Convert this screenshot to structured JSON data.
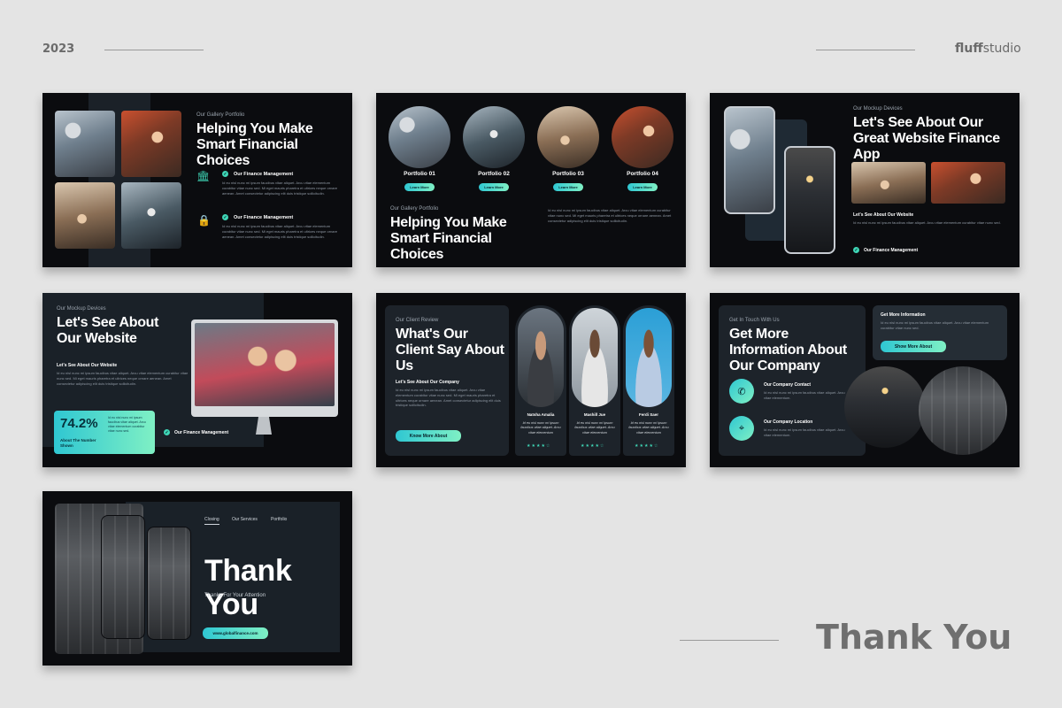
{
  "header": {
    "year": "2023",
    "brand_bold": "fluff",
    "brand_light": "studio"
  },
  "footer": {
    "title": "Thank You"
  },
  "lorem": "Id eu nisl nunc mi ipsum faucibus vitae aliquet. Arcu vitae elementum curabitur vitae nunc sed. Mi eget mauris pharetra et ultrices neque ornare aenean. Amet consectetur adipiscing elit duis tristique sollicitudin.",
  "lorem_short": "Id eu nisl nunc mi ipsum faucibus vitae aliquet. Arcu vitae elementum curabitur vitae nunc sed.",
  "slide1": {
    "eyebrow": "Our Gallery Portfolio",
    "title": "Helping You Make Smart Financial Choices",
    "item1": "Our Finance Management",
    "item2": "Our Finance Management",
    "icon1": "bank-icon",
    "icon2": "lock-icon"
  },
  "slide2": {
    "portfolios": [
      {
        "label": "Portfolio 01",
        "button": "Learn More"
      },
      {
        "label": "Portfolio 02",
        "button": "Learn More"
      },
      {
        "label": "Portfolio 03",
        "button": "Learn More"
      },
      {
        "label": "Portfolio 04",
        "button": "Learn More"
      }
    ],
    "eyebrow": "Our Gallery Portfolio",
    "title": "Helping You Make Smart Financial Choices"
  },
  "slide3": {
    "eyebrow": "Our Mockup Devices",
    "title": "Let's See About Our Great Website Finance App",
    "sub": "Let's See About Our Website",
    "item": "Our Finance Management"
  },
  "slide4": {
    "eyebrow": "Our Mockup Devices",
    "title": "Let's See About Our Website",
    "sub": "Let's See About Our Website",
    "stat_value": "74.2%",
    "stat_label": "About The Number Shown",
    "item": "Our Finance Management"
  },
  "slide5": {
    "eyebrow": "Our Client Review",
    "title": "What's Our Client Say About Us",
    "sub": "Let's See About Our Company",
    "button": "Know More About",
    "reviewers": [
      {
        "name": "Natsha Amalia",
        "quote": "Id eu nisl nunc mi ipsum faucibus vitae aliquet. Arcu vitae elementum",
        "stars": "★★★★☆"
      },
      {
        "name": "Mashill Jue",
        "quote": "Id eu nisl nunc mi ipsum faucibus vitae aliquet. Arcu vitae elementum",
        "stars": "★★★★☆"
      },
      {
        "name": "Ferdi Saer",
        "quote": "Id eu nisl nunc mi ipsum faucibus vitae aliquet. Arcu vitae elementum",
        "stars": "★★★★☆"
      }
    ]
  },
  "slide6": {
    "eyebrow": "Get In Touch With Us",
    "title": "Get More Information About Our Company",
    "info_title": "Get More Information",
    "button": "Show More About",
    "contact_label": "Our Company Contact",
    "location_label": "Our Company Location",
    "contact_text": "Id eu nisl nunc mi ipsum faucibus vitae aliquet. Arcu vitae elementum.",
    "icon1": "phone-icon",
    "icon2": "pin-icon"
  },
  "slide7": {
    "nav": [
      "Closing",
      "Our Services",
      "Portfolio"
    ],
    "title": "Thank You",
    "subtitle": "Thanks For Your Attention",
    "url": "www.globalfinance.com"
  },
  "colors": {
    "accent": "#3fd6b6",
    "accent2": "#2fc7d2",
    "slide_bg": "#0b0c0f",
    "panel": "#1d232a"
  }
}
